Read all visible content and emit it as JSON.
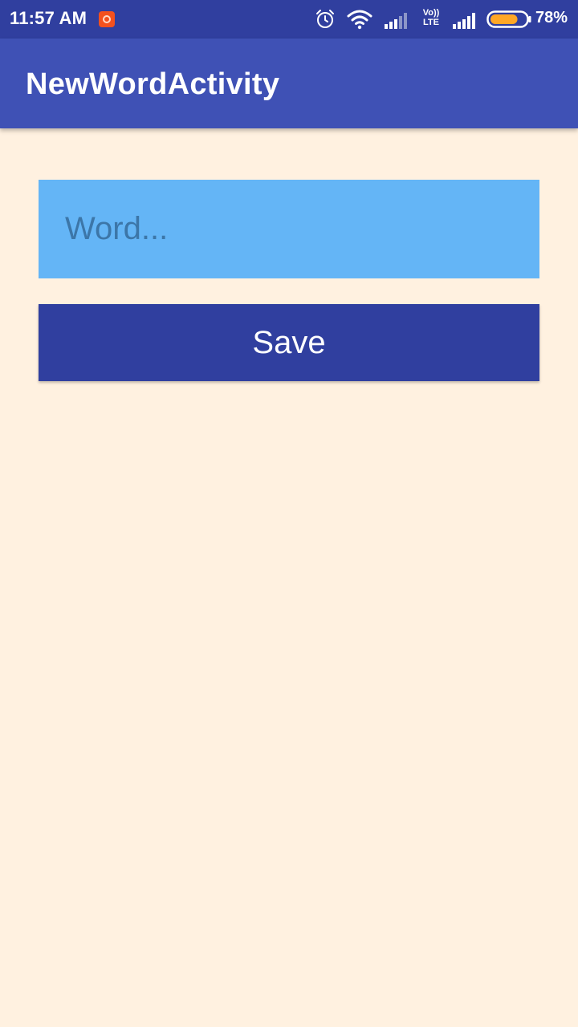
{
  "status_bar": {
    "time": "11:57 AM",
    "network_label": "Vo)) LTE",
    "battery_percent": "78%",
    "battery_level": 0.78,
    "icons": [
      "notification-icon",
      "alarm-icon",
      "wifi-icon",
      "signal-icon",
      "volte-icon",
      "signal-icon",
      "battery-icon"
    ]
  },
  "app_bar": {
    "title": "NewWordActivity"
  },
  "form": {
    "word_placeholder": "Word...",
    "word_value": "",
    "save_label": "Save"
  },
  "colors": {
    "status_bar": "#303F9F",
    "app_bar": "#3F51B5",
    "background": "#FFF1E0",
    "input_background": "#64B5F6",
    "button_background": "#303F9F",
    "battery_fill": "#FFA726"
  }
}
